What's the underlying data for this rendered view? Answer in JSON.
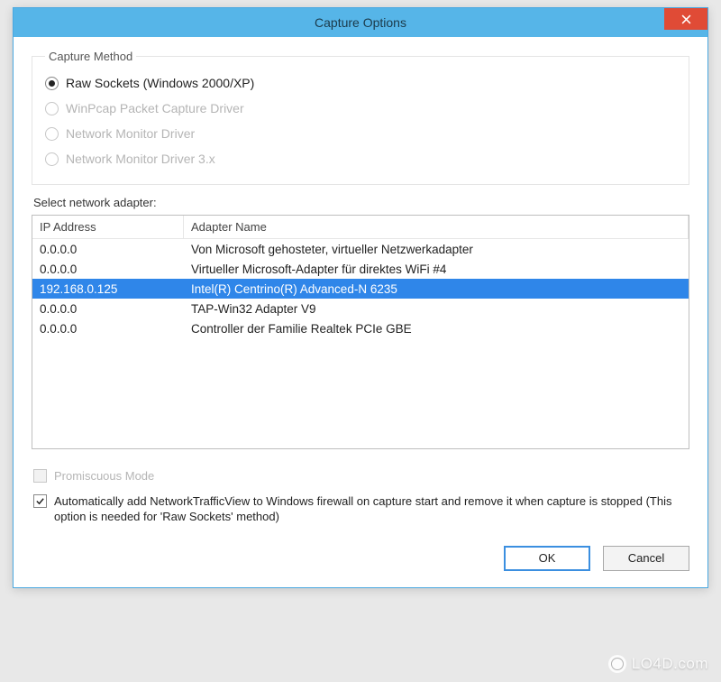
{
  "window": {
    "title": "Capture Options"
  },
  "capture_method": {
    "legend": "Capture Method",
    "options": [
      {
        "label": "Raw Sockets (Windows 2000/XP)",
        "selected": true,
        "enabled": true
      },
      {
        "label": "WinPcap Packet Capture Driver",
        "selected": false,
        "enabled": false
      },
      {
        "label": "Network Monitor Driver",
        "selected": false,
        "enabled": false
      },
      {
        "label": "Network Monitor Driver 3.x",
        "selected": false,
        "enabled": false
      }
    ]
  },
  "adapter_section": {
    "label": "Select network adapter:",
    "columns": {
      "ip": "IP Address",
      "name": "Adapter Name"
    },
    "rows": [
      {
        "ip": "0.0.0.0",
        "name": "Von Microsoft gehosteter, virtueller Netzwerkadapter",
        "selected": false
      },
      {
        "ip": "0.0.0.0",
        "name": "Virtueller Microsoft-Adapter für direktes WiFi #4",
        "selected": false
      },
      {
        "ip": "192.168.0.125",
        "name": "Intel(R) Centrino(R) Advanced-N 6235",
        "selected": true
      },
      {
        "ip": "0.0.0.0",
        "name": "TAP-Win32 Adapter V9",
        "selected": false
      },
      {
        "ip": "0.0.0.0",
        "name": "Controller der Familie Realtek PCIe GBE",
        "selected": false
      }
    ]
  },
  "options": {
    "promiscuous": {
      "label": "Promiscuous Mode",
      "checked": false,
      "enabled": false
    },
    "firewall": {
      "label": "Automatically add NetworkTrafficView to Windows firewall on capture start and remove it when capture is stopped (This option is needed for 'Raw Sockets' method)",
      "checked": true,
      "enabled": true
    }
  },
  "buttons": {
    "ok": "OK",
    "cancel": "Cancel"
  },
  "watermark": "LO4D.com"
}
